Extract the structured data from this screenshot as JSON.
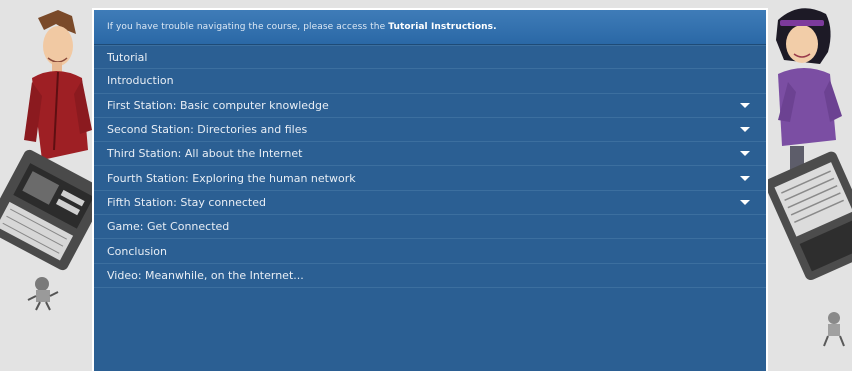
{
  "header": {
    "notice_text": "If you have trouble navigating the course, please access the",
    "link_label": "Tutorial Instructions."
  },
  "menu": {
    "items": [
      {
        "label": "Tutorial",
        "expandable": false
      },
      {
        "label": "Introduction",
        "expandable": false
      },
      {
        "label": "First Station: Basic computer knowledge",
        "expandable": true
      },
      {
        "label": "Second Station: Directories and files",
        "expandable": true
      },
      {
        "label": "Third Station: All about the Internet",
        "expandable": true
      },
      {
        "label": "Fourth Station: Exploring the human network",
        "expandable": true
      },
      {
        "label": "Fifth Station: Stay connected",
        "expandable": true
      },
      {
        "label": "Game: Get Connected",
        "expandable": false
      },
      {
        "label": "Conclusion",
        "expandable": false
      },
      {
        "label": "Video: Meanwhile, on the Internet...",
        "expandable": false
      }
    ]
  },
  "colors": {
    "panel": "#2b5f93",
    "header": "#3f7cb8",
    "page_background": "#e3e3e3"
  }
}
